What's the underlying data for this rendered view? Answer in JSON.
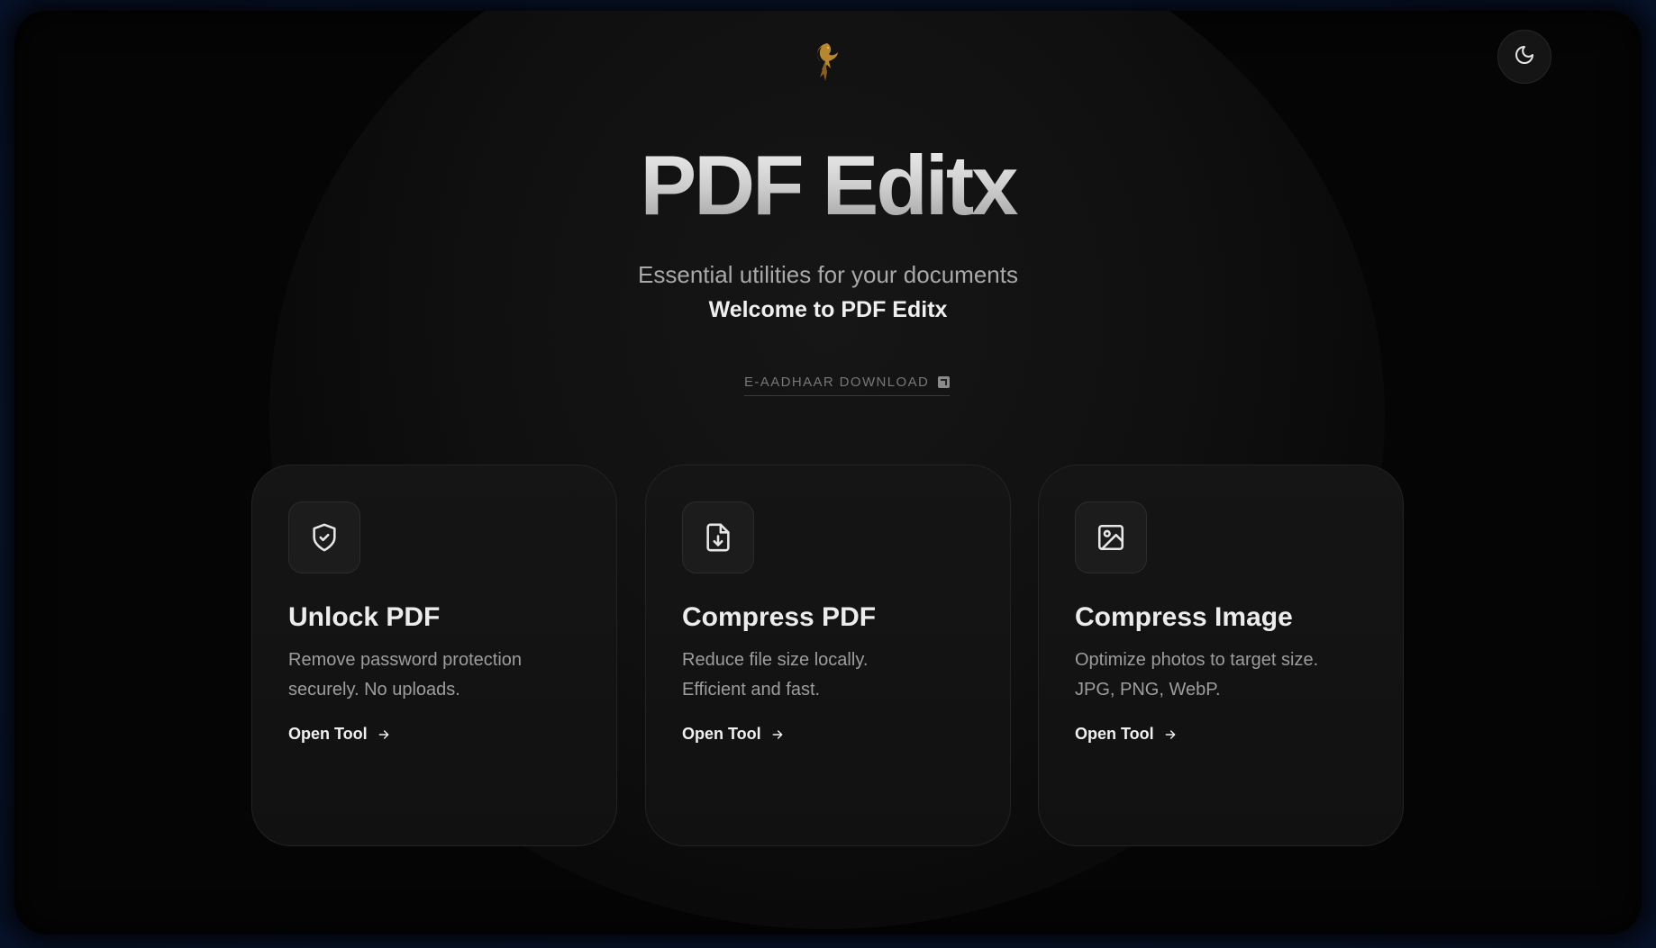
{
  "brand": {
    "logo": "phoenix-bird-logo",
    "title": "PDF Editx",
    "subtitle": "Essential utilities for your documents",
    "welcome": "Welcome to PDF Editx"
  },
  "header": {
    "theme_toggle_icon": "moon-icon"
  },
  "links": {
    "aadhaar_label": "E-AADHAAR DOWNLOAD",
    "aadhaar_icon": "external-link-icon"
  },
  "cards": [
    {
      "icon": "shield-check-icon",
      "title": "Unlock PDF",
      "desc_line1": "Remove password protection",
      "desc_line2": "securely. No uploads.",
      "cta": "Open Tool"
    },
    {
      "icon": "file-download-icon",
      "title": "Compress PDF",
      "desc_line1": "Reduce file size locally.",
      "desc_line2": "Efficient and fast.",
      "cta": "Open Tool"
    },
    {
      "icon": "image-icon",
      "title": "Compress Image",
      "desc_line1": "Optimize photos to target size.",
      "desc_line2": "JPG, PNG, WebP.",
      "cta": "Open Tool"
    }
  ],
  "colors": {
    "background": "#050505",
    "card": "#141414",
    "accent_gold": "#b8862e",
    "frame_blue": "#0f2a55"
  }
}
